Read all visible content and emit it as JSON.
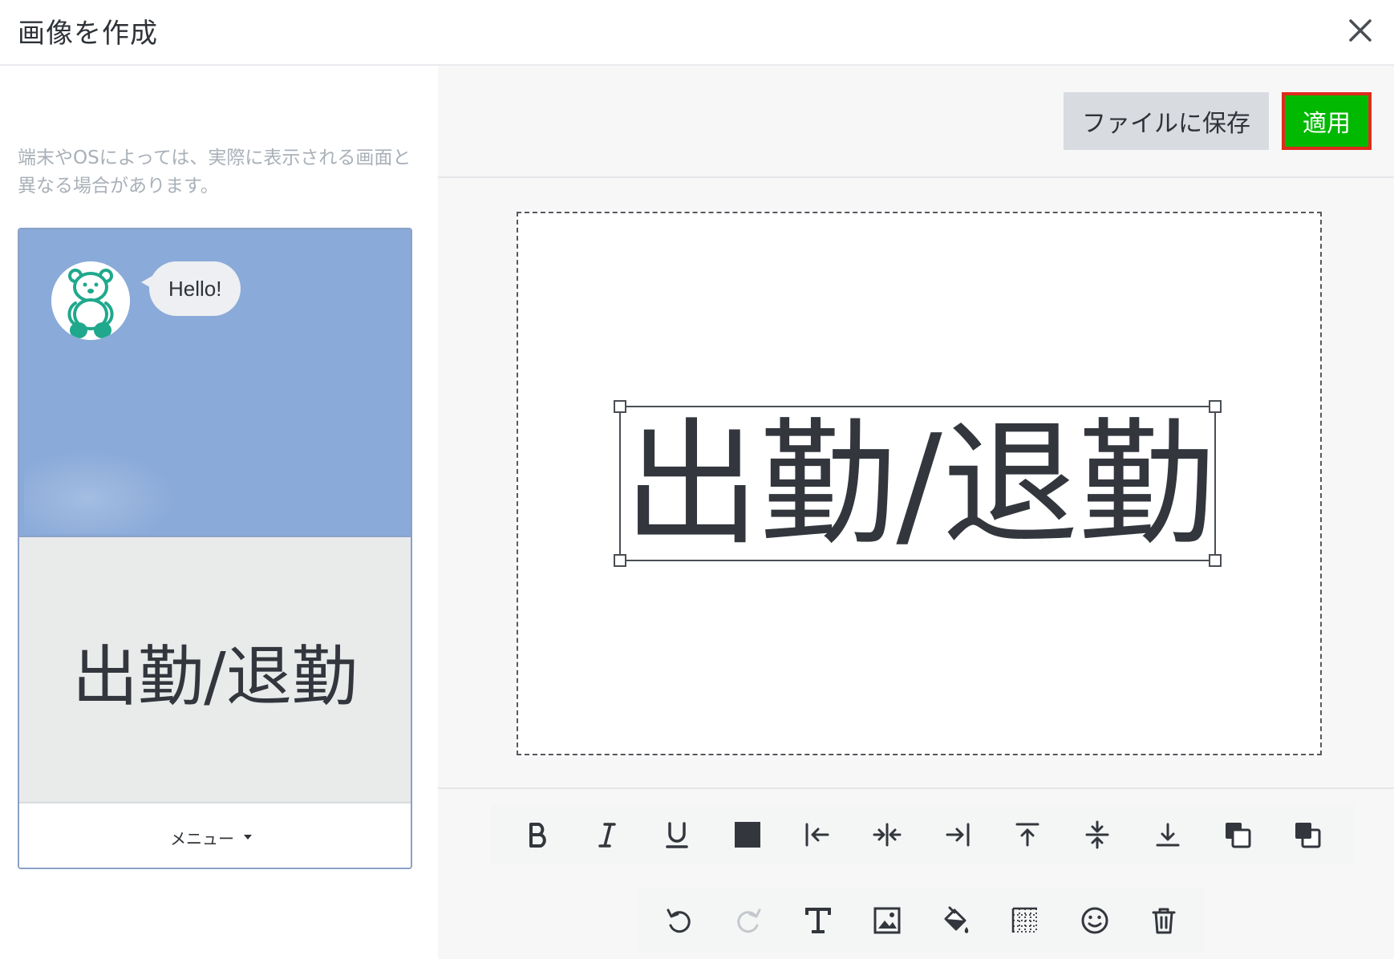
{
  "header": {
    "title": "画像を作成",
    "close_icon": "close-icon"
  },
  "left_panel": {
    "note": "端末やOSによっては、実際に表示される画面と異なる場合があります。",
    "preview": {
      "chat_background": "#8aaad9",
      "avatar_icon": "teddy-bear-icon",
      "bubble_text": "Hello!",
      "richmenu_text": "出勤/退勤",
      "menu_label": "メニュー"
    }
  },
  "actions": {
    "save_label": "ファイルに保存",
    "apply_label": "適用",
    "apply_color": "#00b900",
    "apply_highlight": "#e02a1d"
  },
  "editor": {
    "text": "出勤/退勤",
    "text_color": "#33373d"
  },
  "toolbar_format": [
    {
      "icon": "bold-icon"
    },
    {
      "icon": "italic-icon"
    },
    {
      "icon": "underline-icon"
    },
    {
      "icon": "text-color-swatch-icon",
      "color": "#33373d"
    },
    {
      "icon": "align-left-icon"
    },
    {
      "icon": "align-center-icon"
    },
    {
      "icon": "align-right-icon"
    },
    {
      "icon": "align-top-icon"
    },
    {
      "icon": "align-middle-icon"
    },
    {
      "icon": "align-bottom-icon"
    },
    {
      "icon": "bring-forward-icon"
    },
    {
      "icon": "send-backward-icon"
    }
  ],
  "toolbar_tools": [
    {
      "icon": "undo-icon"
    },
    {
      "icon": "redo-icon",
      "disabled": true
    },
    {
      "icon": "text-icon"
    },
    {
      "icon": "image-icon"
    },
    {
      "icon": "fill-bucket-icon"
    },
    {
      "icon": "grid-icon"
    },
    {
      "icon": "emoji-icon"
    },
    {
      "icon": "trash-icon"
    }
  ]
}
